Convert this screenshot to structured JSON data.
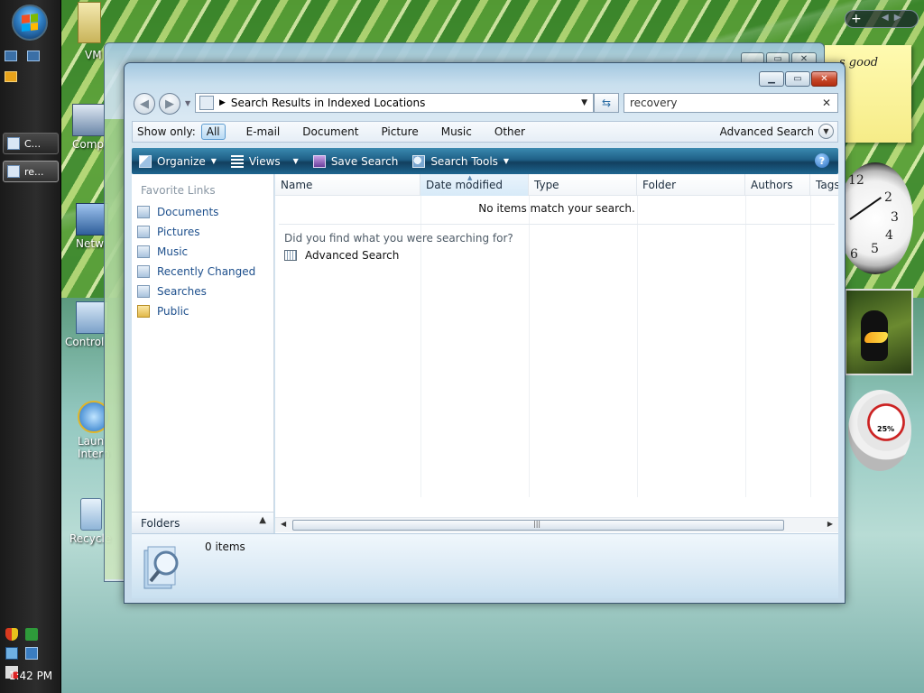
{
  "taskbar": {
    "buttons": [
      {
        "label": "C..."
      },
      {
        "label": "re..."
      }
    ],
    "clock": "1:42 PM"
  },
  "desktop": {
    "icons": [
      {
        "label": "VM"
      },
      {
        "label": "Comp"
      },
      {
        "label": "Netw"
      },
      {
        "label": "Control"
      },
      {
        "label": "Laun"
      },
      {
        "label": "Intern"
      },
      {
        "label": "Recycle"
      }
    ]
  },
  "gadgets": {
    "note_text": "s good",
    "cpu_percent": "25%",
    "clock_numbers": [
      "12",
      "2",
      "3",
      "4",
      "5",
      "6"
    ]
  },
  "window": {
    "address": "Search Results in Indexed Locations",
    "search_value": "recovery",
    "show_only_label": "Show only:",
    "filters": [
      "All",
      "E-mail",
      "Document",
      "Picture",
      "Music",
      "Other"
    ],
    "selected_filter": "All",
    "advanced_search": "Advanced Search",
    "commands": [
      "Organize",
      "Views",
      "Save Search",
      "Search Tools"
    ],
    "favorite_links_title": "Favorite Links",
    "favorites": [
      "Documents",
      "Pictures",
      "Music",
      "Recently Changed",
      "Searches",
      "Public"
    ],
    "folders_label": "Folders",
    "columns": [
      "Name",
      "Date modified",
      "Type",
      "Folder",
      "Authors",
      "Tags"
    ],
    "no_items": "No items match your search.",
    "did_you_find": "Did you find what you were searching for?",
    "advanced_search_link": "Advanced Search",
    "item_count": "0 items"
  }
}
